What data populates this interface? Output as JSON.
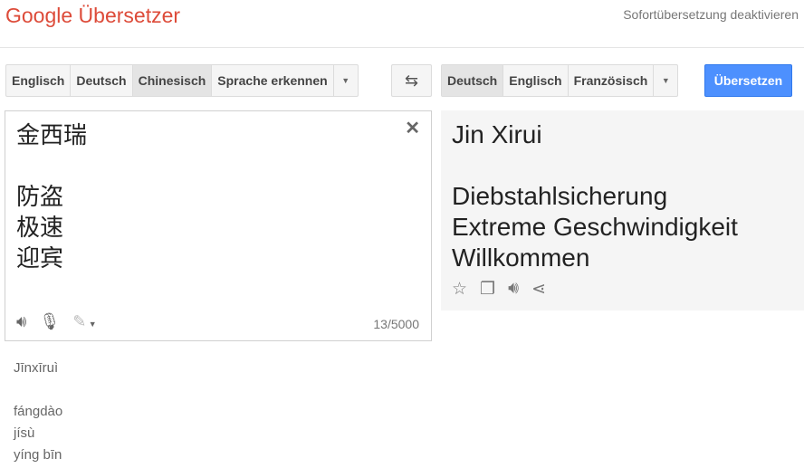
{
  "header": {
    "logo": "Google Übersetzer",
    "instant_toggle": "Sofortübersetzung deaktivieren"
  },
  "source_langs": [
    "Englisch",
    "Deutsch",
    "Chinesisch",
    "Sprache erkennen"
  ],
  "source_selected": "Chinesisch",
  "target_langs": [
    "Deutsch",
    "Englisch",
    "Französisch"
  ],
  "target_selected": "Deutsch",
  "translate_label": "Übersetzen",
  "source": {
    "text": "金西瑞\n\n防盗\n极速\n迎宾",
    "char_count": "13/5000"
  },
  "output": {
    "text": "Jin Xirui\n\nDiebstahlsicherung\nExtreme Geschwindigkeit\nWillkommen"
  },
  "transliteration": "Jīnxīruì\n\nfángdào\njísù\nyíng bīn"
}
